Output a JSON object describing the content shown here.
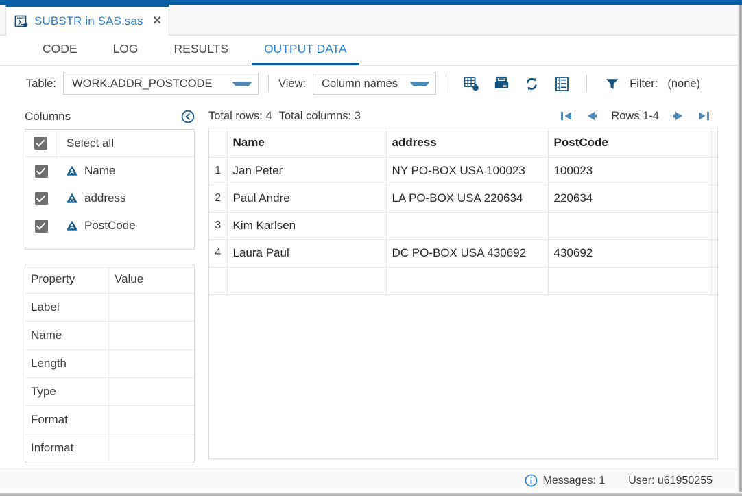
{
  "window": {
    "accent_color": "#0b5ea8",
    "link_color": "#2f7ed0"
  },
  "file_tab": {
    "title": "SUBSTR in SAS.sas",
    "icon": "sas-program-icon",
    "close_label": "✕"
  },
  "section_tabs": [
    {
      "label": "CODE",
      "active": false
    },
    {
      "label": "LOG",
      "active": false
    },
    {
      "label": "RESULTS",
      "active": false
    },
    {
      "label": "OUTPUT DATA",
      "active": true
    }
  ],
  "toolbar": {
    "table_label": "Table:",
    "table_value": "WORK.ADDR_POSTCODE",
    "view_label": "View:",
    "view_value": "Column names",
    "icons": [
      {
        "name": "open-table-properties-icon"
      },
      {
        "name": "print-icon"
      },
      {
        "name": "refresh-icon"
      },
      {
        "name": "column-list-icon"
      }
    ],
    "filter_label": "Filter:",
    "filter_value": "(none)"
  },
  "columns_panel": {
    "heading": "Columns",
    "collapse_icon": "collapse-left-icon",
    "select_all_label": "Select all",
    "items": [
      {
        "label": "Name",
        "type_icon": "char-column-icon",
        "checked": true
      },
      {
        "label": "address",
        "type_icon": "char-column-icon",
        "checked": true
      },
      {
        "label": "PostCode",
        "type_icon": "char-column-icon",
        "checked": true
      }
    ]
  },
  "properties_panel": {
    "header": {
      "key": "Property",
      "value": "Value"
    },
    "rows": [
      {
        "key": "Label",
        "value": ""
      },
      {
        "key": "Name",
        "value": ""
      },
      {
        "key": "Length",
        "value": ""
      },
      {
        "key": "Type",
        "value": ""
      },
      {
        "key": "Format",
        "value": ""
      },
      {
        "key": "Informat",
        "value": ""
      }
    ]
  },
  "grid": {
    "total_rows_label": "Total rows: 4",
    "total_columns_label": "Total columns: 3",
    "rows_range_label": "Rows 1-4",
    "nav": {
      "first": "first-page-icon",
      "prev": "previous-page-icon",
      "next": "next-page-icon",
      "last": "last-page-icon"
    },
    "headers": [
      "Name",
      "address",
      "PostCode"
    ],
    "rows": [
      {
        "n": "1",
        "Name": "Jan Peter",
        "address": "NY PO-BOX USA 100023",
        "PostCode": "100023"
      },
      {
        "n": "2",
        "Name": "Paul Andre",
        "address": "LA PO-BOX USA 220634",
        "PostCode": "220634"
      },
      {
        "n": "3",
        "Name": "Kim Karlsen",
        "address": "",
        "PostCode": ""
      },
      {
        "n": "4",
        "Name": "Laura Paul",
        "address": "DC PO-BOX USA 430692",
        "PostCode": "430692"
      }
    ]
  },
  "status_bar": {
    "messages": "Messages: 1",
    "messages_icon": "info-icon",
    "user": "User: u61950255"
  }
}
